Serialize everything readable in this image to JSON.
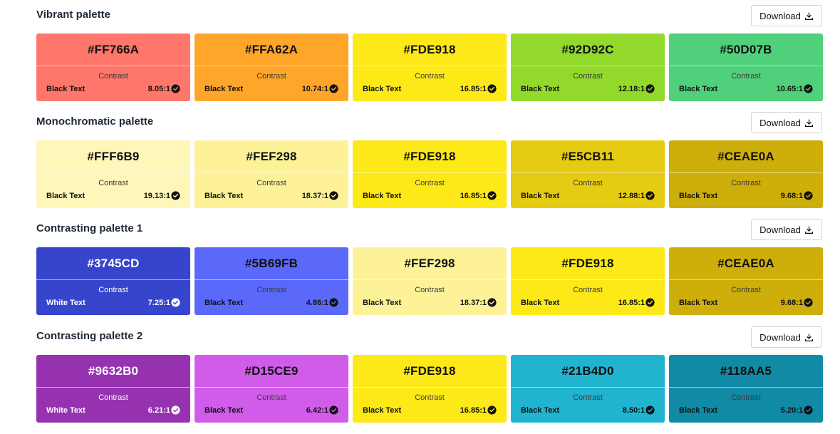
{
  "download_label": "Download",
  "contrast_label": "Contrast",
  "palettes": [
    {
      "title": "Vibrant palette",
      "swatches": [
        {
          "hex": "#FF766A",
          "text_type": "Black Text",
          "ratio": "8.05:1",
          "bg": "#FF766A",
          "fg": "dark"
        },
        {
          "hex": "#FFA62A",
          "text_type": "Black Text",
          "ratio": "10.74:1",
          "bg": "#FFA62A",
          "fg": "dark"
        },
        {
          "hex": "#FDE918",
          "text_type": "Black Text",
          "ratio": "16.85:1",
          "bg": "#FDE918",
          "fg": "dark"
        },
        {
          "hex": "#92D92C",
          "text_type": "Black Text",
          "ratio": "12.18:1",
          "bg": "#92D92C",
          "fg": "dark"
        },
        {
          "hex": "#50D07B",
          "text_type": "Black Text",
          "ratio": "10.65:1",
          "bg": "#50D07B",
          "fg": "dark"
        }
      ]
    },
    {
      "title": "Monochromatic palette",
      "swatches": [
        {
          "hex": "#FFF6B9",
          "text_type": "Black Text",
          "ratio": "19.13:1",
          "bg": "#FFF6B9",
          "fg": "dark"
        },
        {
          "hex": "#FEF298",
          "text_type": "Black Text",
          "ratio": "18.37:1",
          "bg": "#FEF298",
          "fg": "dark"
        },
        {
          "hex": "#FDE918",
          "text_type": "Black Text",
          "ratio": "16.85:1",
          "bg": "#FDE918",
          "fg": "dark"
        },
        {
          "hex": "#E5CB11",
          "text_type": "Black Text",
          "ratio": "12.88:1",
          "bg": "#E5CB11",
          "fg": "dark"
        },
        {
          "hex": "#CEAE0A",
          "text_type": "Black Text",
          "ratio": "9.68:1",
          "bg": "#CEAE0A",
          "fg": "dark"
        }
      ]
    },
    {
      "title": "Contrasting palette 1",
      "swatches": [
        {
          "hex": "#3745CD",
          "text_type": "White Text",
          "ratio": "7.25:1",
          "bg": "#3745CD",
          "fg": "light"
        },
        {
          "hex": "#5B69FB",
          "text_type": "Black Text",
          "ratio": "4.86:1",
          "bg": "#5B69FB",
          "fg": "dark"
        },
        {
          "hex": "#FEF298",
          "text_type": "Black Text",
          "ratio": "18.37:1",
          "bg": "#FEF298",
          "fg": "dark"
        },
        {
          "hex": "#FDE918",
          "text_type": "Black Text",
          "ratio": "16.85:1",
          "bg": "#FDE918",
          "fg": "dark"
        },
        {
          "hex": "#CEAE0A",
          "text_type": "Black Text",
          "ratio": "9.68:1",
          "bg": "#CEAE0A",
          "fg": "dark"
        }
      ]
    },
    {
      "title": "Contrasting palette 2",
      "swatches": [
        {
          "hex": "#9632B0",
          "text_type": "White Text",
          "ratio": "6.21:1",
          "bg": "#9632B0",
          "fg": "light"
        },
        {
          "hex": "#D15CE9",
          "text_type": "Black Text",
          "ratio": "6.42:1",
          "bg": "#D15CE9",
          "fg": "dark"
        },
        {
          "hex": "#FDE918",
          "text_type": "Black Text",
          "ratio": "16.85:1",
          "bg": "#FDE918",
          "fg": "dark"
        },
        {
          "hex": "#21B4D0",
          "text_type": "Black Text",
          "ratio": "8.50:1",
          "bg": "#21B4D0",
          "fg": "dark"
        },
        {
          "hex": "#118AA5",
          "text_type": "Black Text",
          "ratio": "5.20:1",
          "bg": "#118AA5",
          "fg": "dark"
        }
      ]
    }
  ]
}
